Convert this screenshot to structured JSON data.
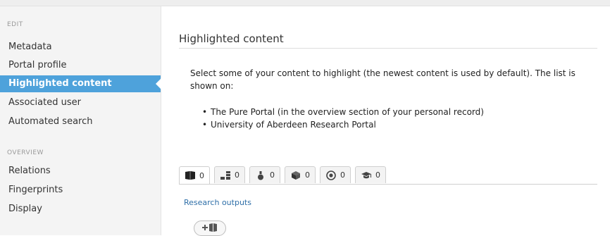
{
  "sidebar": {
    "edit_label": "EDIT",
    "overview_label": "OVERVIEW",
    "edit_items": [
      {
        "label": "Metadata"
      },
      {
        "label": "Portal profile"
      },
      {
        "label": "Highlighted content",
        "active": true
      },
      {
        "label": "Associated user"
      },
      {
        "label": "Automated search"
      }
    ],
    "overview_items": [
      {
        "label": "Relations"
      },
      {
        "label": "Fingerprints"
      },
      {
        "label": "Display"
      }
    ]
  },
  "main": {
    "title": "Highlighted content",
    "description": "Select some of your content to highlight (the newest content is used by default). The list is shown on:",
    "bullets": [
      "The Pure Portal (in the overview section of your personal record)",
      "University of Aberdeen Research Portal"
    ],
    "tabs": [
      {
        "icon": "book-icon",
        "count": "0"
      },
      {
        "icon": "stacked-blocks-icon",
        "count": "0"
      },
      {
        "icon": "flask-icon",
        "count": "0"
      },
      {
        "icon": "cube-icon",
        "count": "0"
      },
      {
        "icon": "target-icon",
        "count": "0"
      },
      {
        "icon": "graduation-cap-icon",
        "count": "0"
      }
    ],
    "section_link": "Research outputs",
    "add_button_icon": "add-book-icon"
  },
  "colors": {
    "accent": "#4ea2db",
    "link": "#2f6fa8",
    "sidebar_bg": "#f4f4f4"
  }
}
